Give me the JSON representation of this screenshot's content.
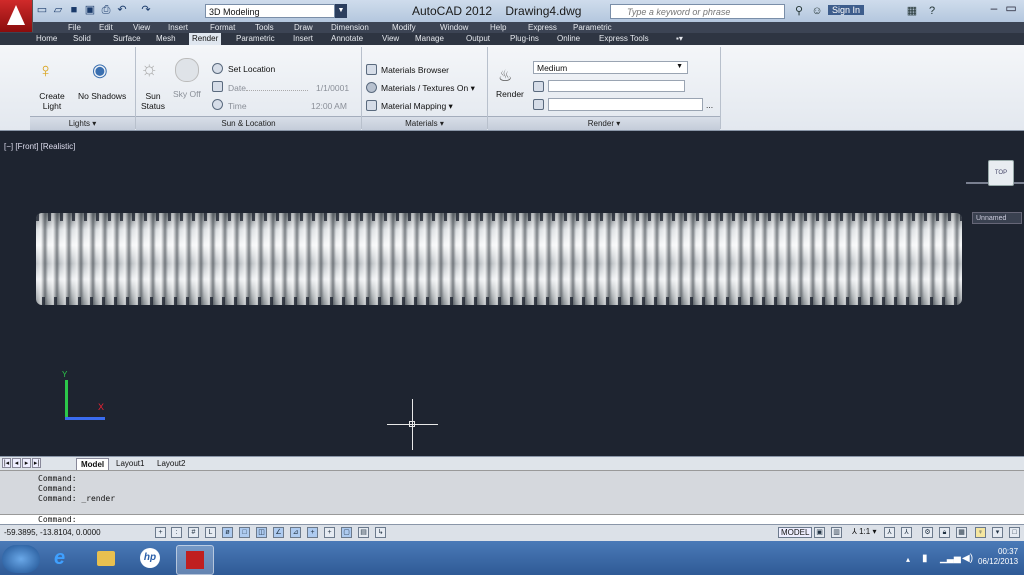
{
  "title_bar": {
    "workspace": "3D Modeling",
    "app_title": "AutoCAD 2012    Drawing4.dwg",
    "search_placeholder": "Type a keyword or phrase",
    "sign_in": "Sign In"
  },
  "menu": [
    "File",
    "Edit",
    "View",
    "Insert",
    "Format",
    "Tools",
    "Draw",
    "Dimension",
    "Modify",
    "Window",
    "Help",
    "Express",
    "Parametric"
  ],
  "tabs": [
    "Home",
    "Solid",
    "Surface",
    "Mesh",
    "Render",
    "Parametric",
    "Insert",
    "Annotate",
    "View",
    "Manage",
    "Output",
    "Plug-ins",
    "Online",
    "Express Tools"
  ],
  "active_tab": "Render",
  "ribbon": {
    "lights": {
      "create_light": "Create\nLight",
      "no_shadows": "No Shadows",
      "footer": "Lights ▾"
    },
    "sun_location": {
      "sun_status": "Sun\nStatus",
      "sky_off": "Sky Off",
      "set_location": "Set Location",
      "date_label": "Date",
      "date_value": "1/1/0001",
      "time_label": "Time",
      "time_value": "12:00 AM",
      "footer": "Sun & Location"
    },
    "materials": {
      "browser": "Materials Browser",
      "textures": "Materials / Textures On ▾",
      "mapping": "Material Mapping ▾",
      "footer": "Materials ▾"
    },
    "render": {
      "render_btn": "Render",
      "quality": "Medium",
      "footer": "Render ▾"
    }
  },
  "viewport": {
    "label": "[−] [Front] [Realistic]",
    "viewcube_face": "TOP",
    "named_view": "Unnamed",
    "ucs_x": "X",
    "ucs_y": "Y"
  },
  "layout_tabs": [
    "Model",
    "Layout1",
    "Layout2"
  ],
  "command_history": [
    "Command:",
    "Command:",
    "Command:  _render"
  ],
  "command_prompt": "Command:",
  "status": {
    "coordinates": "-59.3895, -13.8104, 0.0000",
    "model": "MODEL",
    "scale": "1:1"
  },
  "clock": {
    "time": "00:37",
    "date": "06/12/2013"
  },
  "colors": {
    "viewport_bg": "#1e2430",
    "ucs_y": "#2cc84a",
    "ucs_x_axis": "#3a6cf0",
    "ucs_x_label": "#e22233",
    "app_red": "#c01f1f"
  }
}
